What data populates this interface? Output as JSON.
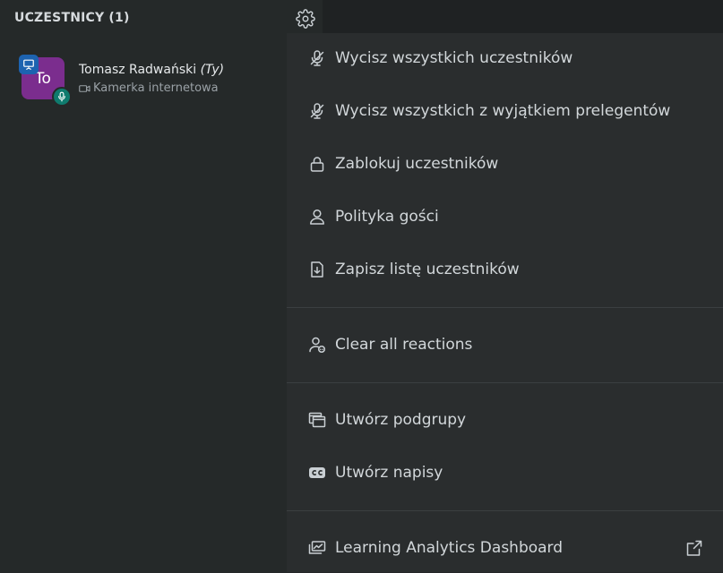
{
  "participants": {
    "title": "UCZESTNICY (1)"
  },
  "user": {
    "initials": "To",
    "name": "Tomasz Radwański",
    "you_tag": "(Ty)",
    "status": "Kamerka internetowa"
  },
  "menu": {
    "items": [
      {
        "label": "Wycisz wszystkich uczestników",
        "icon": "mic-off-icon"
      },
      {
        "label": "Wycisz wszystkich z wyjątkiem prelegentów",
        "icon": "mic-off-icon"
      },
      {
        "label": "Zablokuj uczestników",
        "icon": "lock-icon"
      },
      {
        "label": "Polityka gości",
        "icon": "user-icon"
      },
      {
        "label": "Zapisz listę uczestników",
        "icon": "download-file-icon"
      },
      {
        "label": "Clear all reactions",
        "icon": "user-reaction-icon"
      },
      {
        "label": "Utwórz podgrupy",
        "icon": "rooms-icon"
      },
      {
        "label": "Utwórz napisy",
        "icon": "closed-captions-icon"
      },
      {
        "label": "Learning Analytics Dashboard",
        "icon": "dashboard-icon",
        "external_icon": "external-link-icon"
      }
    ]
  },
  "colors": {
    "avatar": "#7b2d8e",
    "presenter_badge": "#1d63b0",
    "mic_badge": "#0f7b6e",
    "menu_bg": "#2a2d2e"
  }
}
